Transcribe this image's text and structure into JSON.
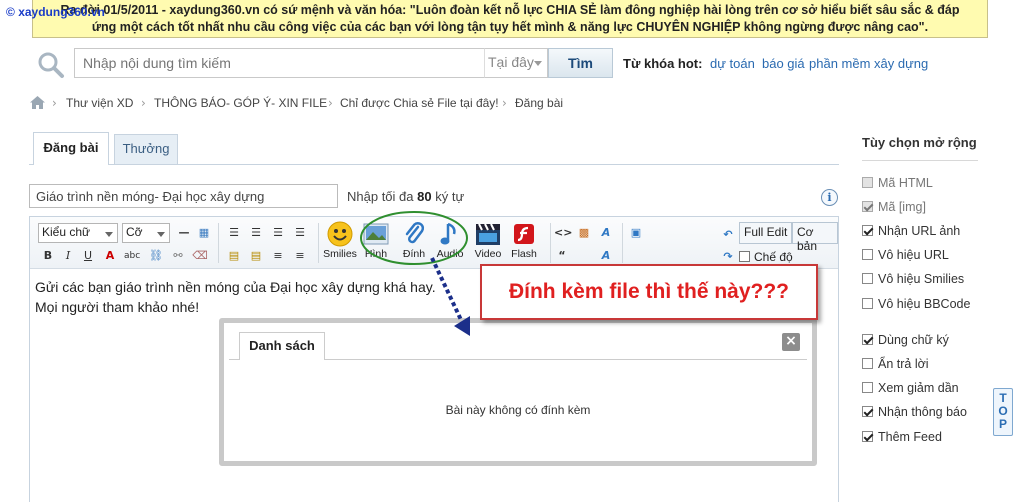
{
  "watermark": "xaydung360.vn",
  "banner": {
    "line1": "Ra đời 01/5/2011 - xaydung360.vn có sứ mệnh và văn hóa: \"Luôn đoàn kết nỗ lực CHIA SẺ làm đông nghiệp hài lòng trên cơ sở hiểu biết sâu sắc & đáp",
    "line2": "ứng một cách tốt nhất nhu cầu công việc của các bạn với lòng tận tụy hết mình & năng lực CHUYÊN NGHIỆP không ngừng được nâng cao\"."
  },
  "search": {
    "placeholder": "Nhập nội dung tìm kiếm",
    "scope": "Tại đây",
    "button": "Tìm",
    "hot_label": "Từ khóa hot:",
    "hot_links": [
      "dự toán",
      "báo giá",
      "phần mềm xây dựng"
    ]
  },
  "breadcrumb": [
    "Thư viện XD",
    "THÔNG BÁO- GÓP Ý- XIN FILE",
    "Chỉ được Chia sẻ File tại đây!",
    "Đăng bài"
  ],
  "tabs": {
    "active": "Đăng bài",
    "inactive": "Thưởng"
  },
  "title_field": {
    "value": "Giáo trình nền móng- Đại học xây dựng",
    "hint_prefix": "Nhập tối đa",
    "hint_count": "80",
    "hint_suffix": "ký tự"
  },
  "toolbar": {
    "font_select": "Kiểu chữ",
    "size_select": "Cỡ",
    "smilies": "Smilies",
    "image": "Hình",
    "attach": "Đính",
    "audio": "Audio",
    "video": "Video",
    "flash": "Flash",
    "full_edit": "Full Edit",
    "basic": "Cơ bản",
    "mode": "Chế độ"
  },
  "editor": {
    "line1": "Gửi các bạn giáo trình nền móng của Đại học xây dựng khá hay.",
    "line2": "Mọi người tham khảo nhé!"
  },
  "attachments": {
    "tab": "Danh sách",
    "empty": "Bài này không có đính kèm"
  },
  "annotation": {
    "text": "Đính kèm file thì thế này???",
    "color": "#e02020"
  },
  "sidebar": {
    "title": "Tùy chọn mở rộng",
    "options": [
      {
        "label": "Mã HTML",
        "checked": false,
        "disabled": true
      },
      {
        "label": "Mã [img]",
        "checked": true,
        "disabled": true
      },
      {
        "label": "Nhận URL ảnh",
        "checked": true,
        "disabled": false
      },
      {
        "label": "Vô hiệu URL",
        "checked": false,
        "disabled": false
      },
      {
        "label": "Vô hiệu Smilies",
        "checked": false,
        "disabled": false
      },
      {
        "label": "Vô hiệu BBCode",
        "checked": false,
        "disabled": false
      },
      {
        "label": "Dùng chữ ký",
        "checked": true,
        "disabled": false
      },
      {
        "label": "Ẩn trả lời",
        "checked": false,
        "disabled": false
      },
      {
        "label": "Xem giảm dần",
        "checked": false,
        "disabled": false
      },
      {
        "label": "Nhận thông báo",
        "checked": true,
        "disabled": false
      },
      {
        "label": "Thêm Feed",
        "checked": true,
        "disabled": false
      }
    ]
  },
  "top_button": "TOP"
}
